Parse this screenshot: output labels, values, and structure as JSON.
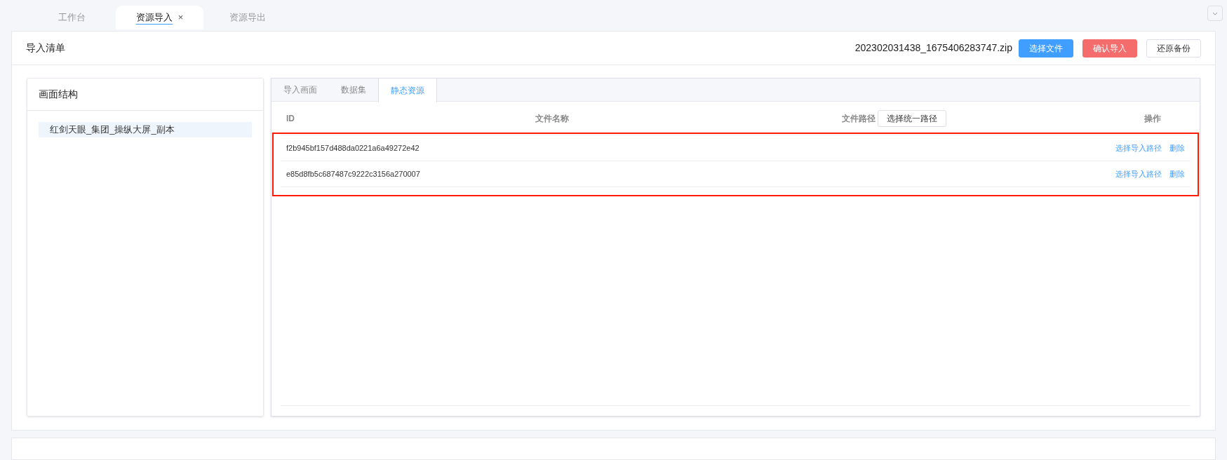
{
  "top_tabs": [
    {
      "label": "工作台",
      "selected": false
    },
    {
      "label": "资源导入",
      "selected": true,
      "close": "×"
    },
    {
      "label": "资源导出",
      "selected": false
    }
  ],
  "header": {
    "title": "导入清单",
    "file_name": "202302031438_1675406283747.zip",
    "buttons": [
      {
        "label": "选择文件",
        "kind": "primary"
      },
      {
        "label": "确认导入",
        "kind": "danger"
      },
      {
        "label": "还原备份",
        "kind": "default"
      }
    ]
  },
  "structure": {
    "title": "画面结构",
    "items": [
      {
        "label": "红剑天眼_集团_操纵大屏_副本",
        "selected": true
      }
    ]
  },
  "inner_tabs": [
    {
      "label": "导入画面",
      "selected": false
    },
    {
      "label": "数据集",
      "selected": false
    },
    {
      "label": "静态资源",
      "selected": true
    }
  ],
  "table": {
    "columns": [
      "ID",
      "文件名称",
      "文件路径",
      "操作"
    ],
    "path_button": "选择统一路径",
    "rows": [
      {
        "id": "f2b945bf157d488da0221a6a49272e42",
        "actions": [
          "选择导入路径",
          "删除"
        ]
      },
      {
        "id": "e85d8fb5c687487c9222c3156a270007",
        "actions": [
          "选择导入路径",
          "删除"
        ]
      }
    ]
  },
  "highlight": true
}
